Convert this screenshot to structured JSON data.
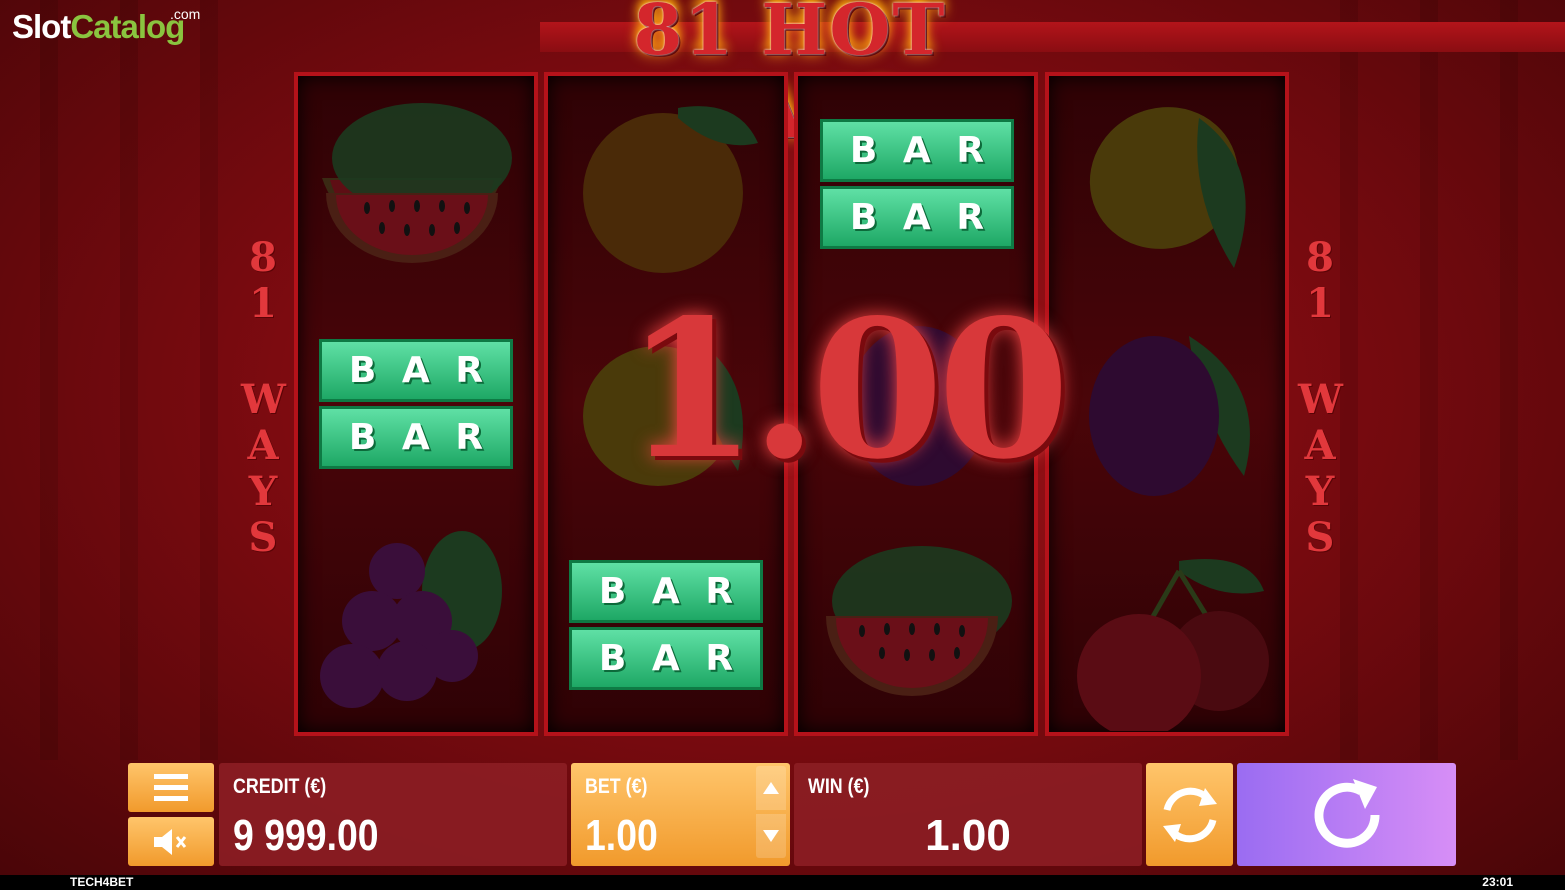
{
  "brand_logo": {
    "main": "Slot",
    "accent": "Catalog",
    "suffix": ".com"
  },
  "game_title": "81 HOT WAYS",
  "side_labels": {
    "number": [
      "8",
      "1"
    ],
    "word": [
      "W",
      "A",
      "Y",
      "S"
    ]
  },
  "reels": [
    [
      "watermelon-icon",
      "bar-icon",
      "grapes-icon"
    ],
    [
      "orange-icon",
      "lemon-icon",
      "bar-icon"
    ],
    [
      "bar-icon",
      "plum-icon",
      "watermelon-icon"
    ],
    [
      "lemon-icon",
      "plum-icon",
      "cherries-icon"
    ]
  ],
  "bar_symbol": {
    "row_text": [
      "B",
      "A",
      "R"
    ]
  },
  "win_overlay": "1.00",
  "controls": {
    "credit": {
      "label": "CREDIT (€)",
      "value": "9 999.00"
    },
    "bet": {
      "label": "BET (€)",
      "value": "1.00"
    },
    "win": {
      "label": "WIN (€)",
      "value": "1.00"
    },
    "menu_icon": "hamburger-menu-icon",
    "sound_icon": "mute-speaker-icon",
    "autoplay_icon": "autoplay-icon",
    "spin_icon": "spin-icon"
  },
  "footer": {
    "provider": "TECH4BET",
    "clock": "23:01"
  },
  "colors": {
    "background": "#8a0d12",
    "accent_orange": "#f19a2c",
    "spin_purple": "#b07cf4",
    "bar_green": "#2ec07a"
  }
}
